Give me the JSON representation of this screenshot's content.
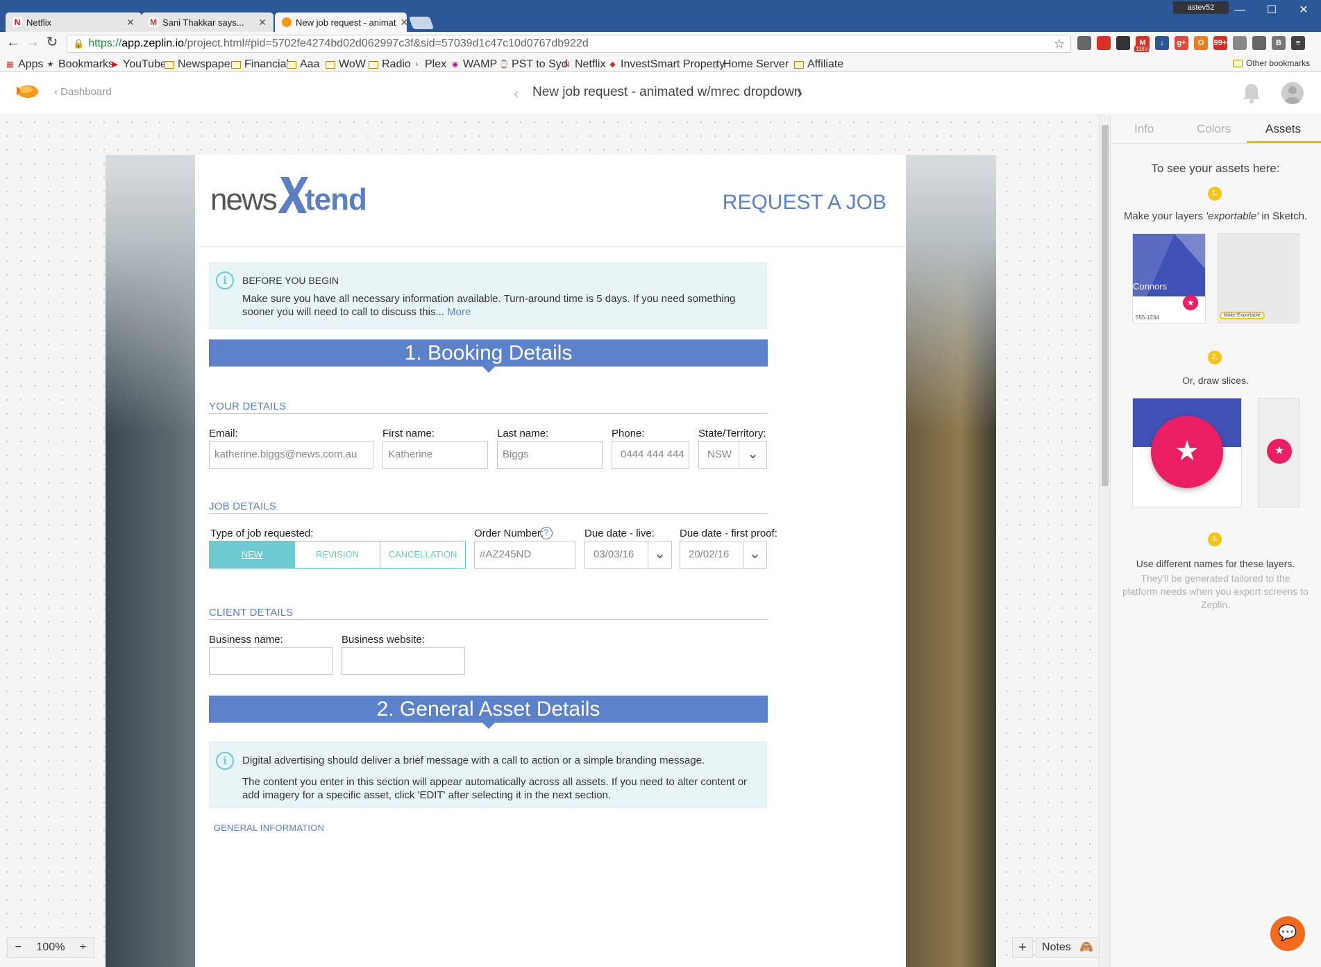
{
  "browser": {
    "tabs": [
      {
        "title": "Netflix",
        "icon": "netflix-icon",
        "color": "#e50914"
      },
      {
        "title": "Sani Thakkar says...",
        "icon": "gmail-icon",
        "color": "#d93025"
      },
      {
        "title": "New job request - animat",
        "icon": "zeplin-icon",
        "color": "#f49a1a"
      }
    ],
    "user": "astev52",
    "url": {
      "scheme": "https://",
      "host": "app.zeplin.io",
      "path": "/project.html#pid=5702fe4274bd02d062997c3f&sid=57039d1c47c10d0767db922d"
    },
    "extensions": [
      {
        "icon": "pencil-icon",
        "color": "#666",
        "label": ""
      },
      {
        "icon": "calendar-icon",
        "color": "#d93025",
        "label": ""
      },
      {
        "icon": "gear-icon",
        "color": "#333",
        "label": ""
      },
      {
        "icon": "gmail-icon",
        "color": "#d93025",
        "label": "M"
      },
      {
        "icon": "download-icon",
        "color": "#2b5797",
        "label": "↓"
      },
      {
        "icon": "google-plus-icon",
        "color": "#dd4b39",
        "label": "g+"
      },
      {
        "icon": "office-icon",
        "color": "#e67e22",
        "label": "O"
      },
      {
        "icon": "notification-icon",
        "color": "#d93025",
        "label": "99+"
      },
      {
        "icon": "cube-icon",
        "color": "#888",
        "label": ""
      },
      {
        "icon": "circle-icon",
        "color": "#666",
        "label": ""
      },
      {
        "icon": "b-icon",
        "color": "#777",
        "label": "B"
      },
      {
        "icon": "menu-icon",
        "color": "#444",
        "label": "≡"
      }
    ],
    "gmail_badge": "1183",
    "bookmarks": [
      {
        "label": "Apps",
        "icon": "apps-grid-icon"
      },
      {
        "label": "Bookmarks",
        "icon": "star-icon"
      },
      {
        "label": "YouTube",
        "icon": "youtube-icon"
      },
      {
        "label": "Newspapers",
        "icon": "folder-icon"
      },
      {
        "label": "Financial",
        "icon": "folder-icon"
      },
      {
        "label": "Aaa",
        "icon": "folder-icon"
      },
      {
        "label": "WoW",
        "icon": "folder-icon"
      },
      {
        "label": "Radio",
        "icon": "folder-icon"
      },
      {
        "label": "Plex",
        "icon": "plex-icon"
      },
      {
        "label": "WAMP",
        "icon": "wamp-icon"
      },
      {
        "label": "PST to Syd",
        "icon": "clock-icon"
      },
      {
        "label": "Netflix",
        "icon": "netflix-icon"
      },
      {
        "label": "InvestSmart Property",
        "icon": "investsmart-icon"
      },
      {
        "label": "Home Server",
        "icon": "page-icon"
      },
      {
        "label": "Affiliate",
        "icon": "folder-icon"
      }
    ],
    "other_bookmarks": "Other bookmarks"
  },
  "zeplin": {
    "dashboard": "Dashboard",
    "screen_title": "New job request - animated w/mrec dropdown",
    "zoom": "100%",
    "notes": "Notes",
    "panel": {
      "tabs": [
        "Info",
        "Colors",
        "Assets"
      ],
      "active_tab": "Assets",
      "heading": "To see your assets here:",
      "step1_num": "1.",
      "step1_pre": "Make your layers ",
      "step1_em": "'exportable'",
      "step1_post": " in Sketch.",
      "step2_num": "2.",
      "step2": "Or, draw slices.",
      "step3_num": "3.",
      "step3": "Use different names for these layers.",
      "step3_muted": "They'll be generated tailored to the platform needs when you export screens to Zeplin.",
      "thumb_name": "Connors",
      "thumb_phone": "555-1234",
      "thumb_action": "Make Exportable"
    }
  },
  "design": {
    "logo_news": "news",
    "logo_tend": "tend",
    "request_title": "REQUEST A JOB",
    "before": {
      "title": "BEFORE YOU BEGIN",
      "body": "Make sure you have all necessary information available.  Turn-around time is 5 days. If you need something sooner you will need to call to discuss this...",
      "more": "More"
    },
    "section1": "1. Booking Details",
    "your_details": "YOUR DETAILS",
    "fields": {
      "email_label": "Email:",
      "email_value": "katherine.biggs@news.com.au",
      "first_label": "First name:",
      "first_value": "Katherine",
      "last_label": "Last name:",
      "last_value": "Biggs",
      "phone_label": "Phone:",
      "phone_value": "0444 444 444",
      "state_label": "State/Territory:",
      "state_value": "NSW"
    },
    "job_details": "JOB DETAILS",
    "job": {
      "type_label": "Type of job requested:",
      "types": [
        "NEW",
        "REVISION",
        "CANCELLATION"
      ],
      "selected": "NEW",
      "order_label": "Order Number:",
      "order_value": "#AZ245ND",
      "live_label": "Due date - live:",
      "live_value": "03/03/16",
      "proof_label": "Due date - first proof:",
      "proof_value": "20/02/16"
    },
    "client_details": "CLIENT DETAILS",
    "client": {
      "business_label": "Business name:",
      "website_label": "Business website:"
    },
    "section2": "2. General Asset Details",
    "asset_info": {
      "p1": "Digital advertising should deliver a brief message with a call to action or a simple branding message.",
      "p2": "The content you enter in this section will appear automatically across all assets. If you need to alter content or add imagery for a specific asset, click 'EDIT' after selecting it in the next section."
    },
    "general_info": "GENERAL INFORMATION"
  },
  "colors": {
    "accent": "#5b82c8",
    "teal": "#6cc9cf",
    "zeplin_orange": "#f49a1a",
    "panel_yellow": "#f5c516",
    "help_fab": "#f26b1d"
  }
}
